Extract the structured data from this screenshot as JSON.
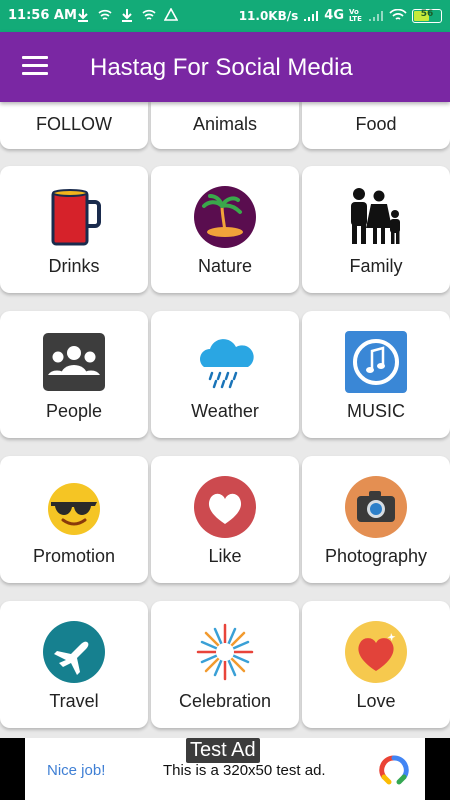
{
  "status_bar": {
    "time": "11:56 AM",
    "speed": "11.0KB/s",
    "network": "4G",
    "volte": "Vo LTE",
    "battery": "56"
  },
  "app_bar": {
    "title": "Hastag For Social Media",
    "menu_icon": "hamburger-menu-icon"
  },
  "categories": [
    {
      "label": "FOLLOW"
    },
    {
      "label": "Animals"
    },
    {
      "label": "Food"
    },
    {
      "label": "Drinks",
      "icon": "mug-icon"
    },
    {
      "label": "Nature",
      "icon": "palm-tree-island-icon"
    },
    {
      "label": "Family",
      "icon": "family-icon"
    },
    {
      "label": "People",
      "icon": "people-group-icon"
    },
    {
      "label": "Weather",
      "icon": "rain-cloud-icon"
    },
    {
      "label": "MUSIC",
      "icon": "music-note-icon"
    },
    {
      "label": "Promotion",
      "icon": "sunglasses-emoji-icon"
    },
    {
      "label": "Like",
      "icon": "heart-like-icon"
    },
    {
      "label": "Photography",
      "icon": "camera-icon"
    },
    {
      "label": "Travel",
      "icon": "airplane-icon"
    },
    {
      "label": "Celebration",
      "icon": "fireworks-icon"
    },
    {
      "label": "Love",
      "icon": "love-heart-icon"
    }
  ],
  "ad": {
    "badge": "Test Ad",
    "cta": "Nice job!",
    "text": "This is a 320x50 test ad."
  },
  "colors": {
    "status_bar": "#13ab78",
    "app_bar": "#7a27a3",
    "ad_link": "#3f7fd4"
  }
}
